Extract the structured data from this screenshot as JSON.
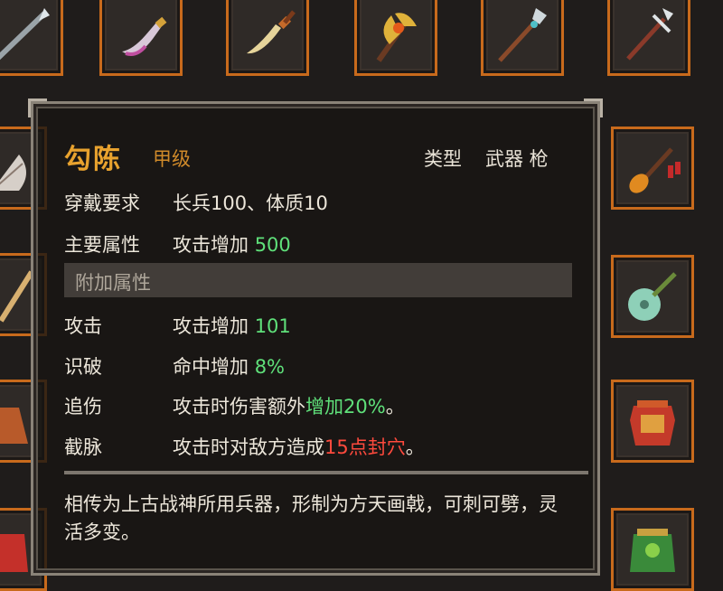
{
  "item": {
    "name": "勾陈",
    "grade": "甲级",
    "type_label": "类型",
    "type_value": "武器 枪"
  },
  "rows": {
    "requirement": {
      "label": "穿戴要求",
      "value": "长兵100、体质10"
    },
    "main_attr": {
      "label": "主要属性",
      "prefix": "攻击增加 ",
      "number": "500"
    },
    "section_title": "附加属性",
    "attack": {
      "label": "攻击",
      "prefix": "攻击增加 ",
      "number": "101"
    },
    "pierce": {
      "label": "识破",
      "prefix": "命中增加 ",
      "number": "8%"
    },
    "chase": {
      "label": "追伤",
      "prefix": "攻击时伤害额外",
      "highlight": "增加20%",
      "suffix": "。"
    },
    "sever": {
      "label": "截脉",
      "prefix": "攻击时对敌方造成",
      "highlight": "15点封穴",
      "suffix": "。"
    }
  },
  "description": "相传为上古战神所用兵器，形制为方天画戟，可刺可劈，灵活多变。",
  "colors": {
    "slot_border": "#c86a1c",
    "title": "#e8a22e",
    "bonus_green": "#5fe07a",
    "bonus_red": "#ff4a3d"
  },
  "inventory_icons": [
    "spear-icon",
    "curved-blade-icon",
    "saber-icon",
    "battle-axe-icon",
    "jeweled-spear-icon",
    "trident-icon",
    "fan-icon",
    "tassel-spear-icon",
    "staff-icon",
    "pipa-lute-icon",
    "robe-icon",
    "red-armor-icon",
    "scale-armor-icon",
    "green-armor-icon"
  ]
}
